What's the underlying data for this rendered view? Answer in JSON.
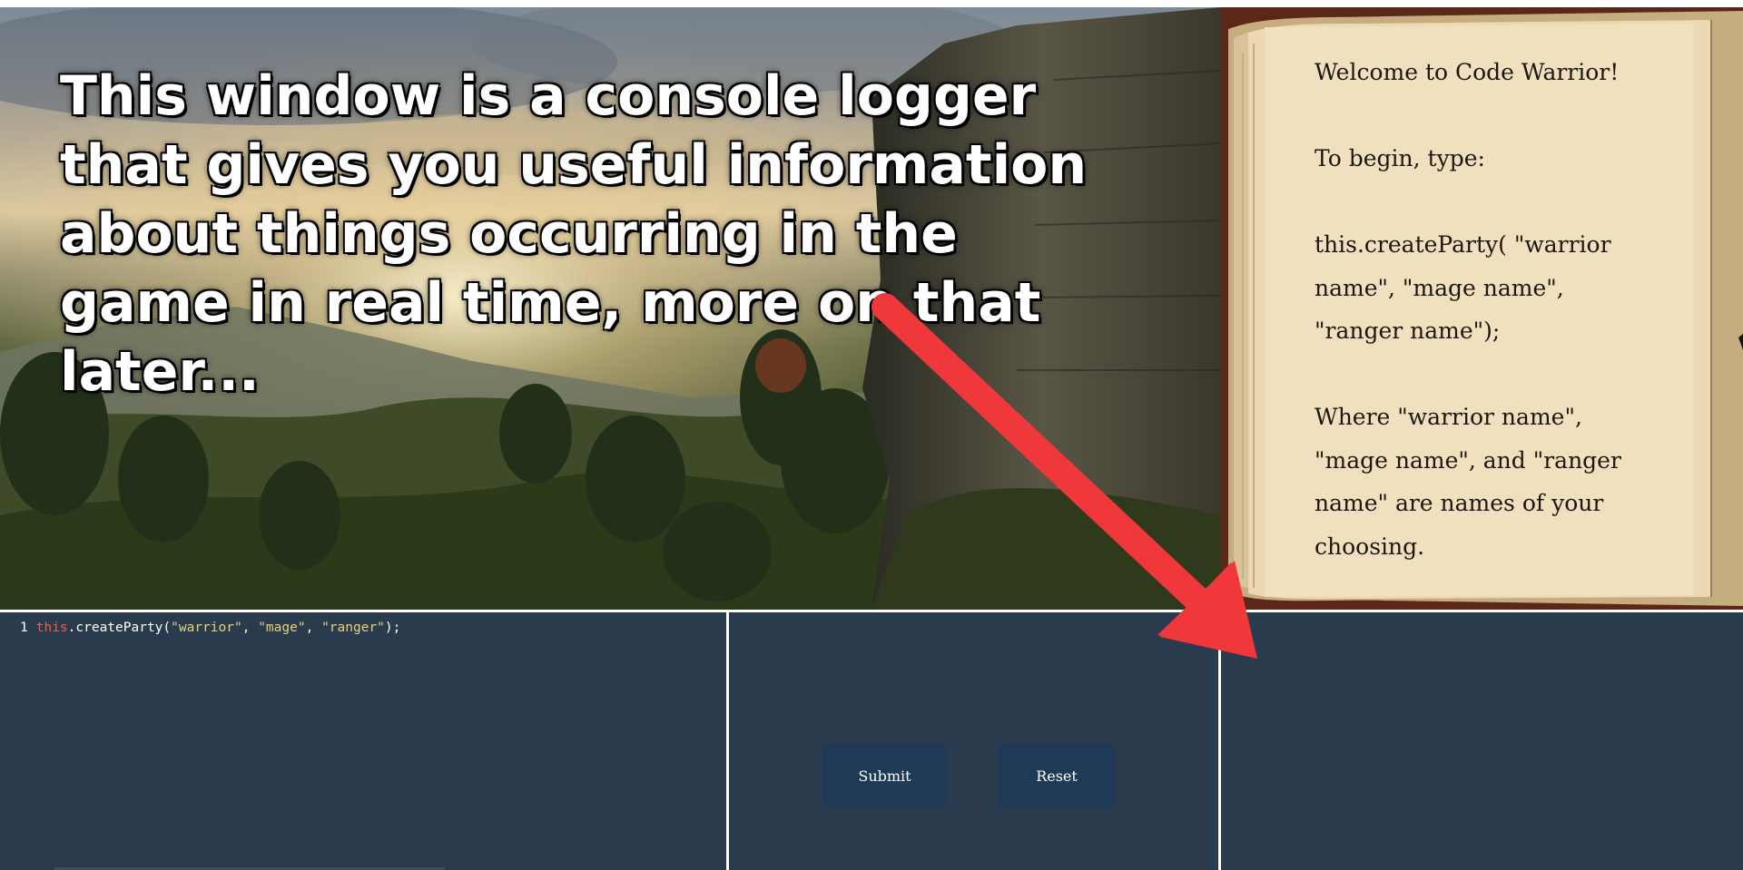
{
  "tutorial": {
    "message": "This window is a console logger that gives you useful information about things occurring in the game in real time, more on that later..."
  },
  "book": {
    "lines": [
      "Welcome to Code Warrior!",
      "To begin, type:",
      "this.createParty( \"warrior name\", \"mage name\", \"ranger name\");",
      "Where \"warrior name\", \"mage name\", and \"ranger name\" are names of your choosing."
    ]
  },
  "editor": {
    "line_number": "1",
    "code": {
      "keyword": "this",
      "method": ".createParty(",
      "arg1": "\"warrior\"",
      "sep1": ", ",
      "arg2": "\"mage\"",
      "sep2": ", ",
      "arg3": "\"ranger\"",
      "end": ");"
    }
  },
  "controls": {
    "submit_label": "Submit",
    "reset_label": "Reset"
  },
  "colors": {
    "panel_bg": "#2b3b4e",
    "button_bg": "#1f3a57",
    "arrow": "#f0383b",
    "keyword": "#e85f4c",
    "string": "#e5d27a"
  },
  "icons": {
    "annotation_arrow": "red-arrow-icon"
  }
}
